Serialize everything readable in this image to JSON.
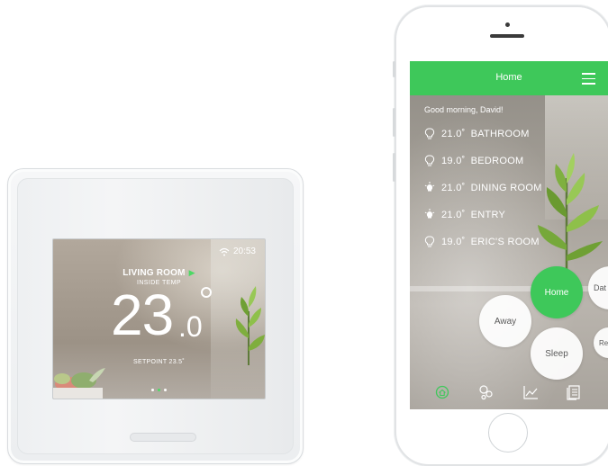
{
  "thermostat": {
    "time": "20:53",
    "room": "LIVING ROOM",
    "inside_label": "INSIDE TEMP",
    "temp_int": "23",
    "temp_dec": ".0",
    "setpoint": "SETPOINT 23.5˚",
    "page_dots": 3,
    "active_dot": 1
  },
  "app": {
    "title": "Home",
    "greeting": "Good morning, David!",
    "rooms": [
      {
        "temp": "21.0˚",
        "name": "BATHROOM",
        "icon": "bulb-outline-icon"
      },
      {
        "temp": "19.0˚",
        "name": "BEDROOM",
        "icon": "bulb-outline-icon"
      },
      {
        "temp": "21.0˚",
        "name": "DINING ROOM",
        "icon": "bulb-on-icon"
      },
      {
        "temp": "21.0˚",
        "name": "ENTRY",
        "icon": "bulb-on-icon"
      },
      {
        "temp": "19.0˚",
        "name": "ERIC'S ROOM",
        "icon": "bulb-outline-icon"
      }
    ],
    "modes": {
      "home": "Home",
      "away": "Away",
      "sleep": "Sleep",
      "date": "Dat",
      "re": "Re"
    },
    "tabs": [
      "home-tab-icon",
      "scenes-tab-icon",
      "chart-tab-icon",
      "list-tab-icon"
    ]
  },
  "colors": {
    "accent_green": "#3ec85a",
    "white": "#ffffff"
  }
}
